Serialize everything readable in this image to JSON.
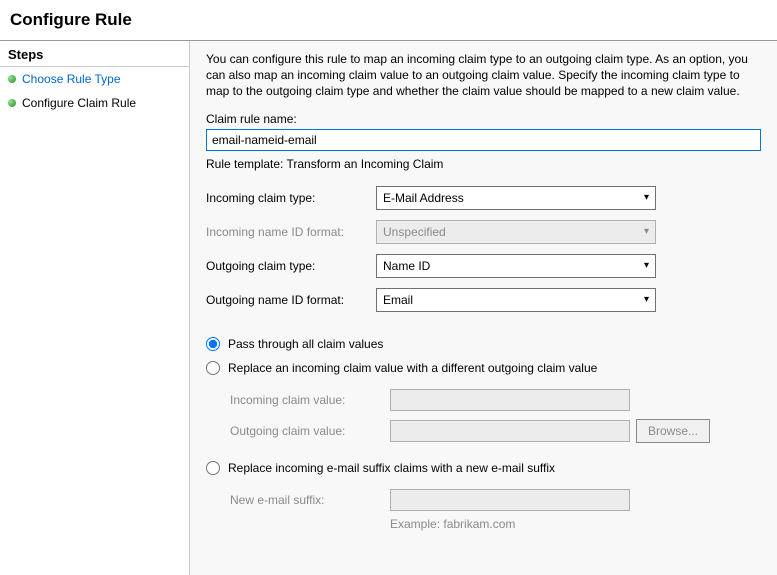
{
  "window_title": "Configure Rule",
  "sidebar": {
    "header": "Steps",
    "items": [
      {
        "label": "Choose Rule Type"
      },
      {
        "label": "Configure Claim Rule"
      }
    ]
  },
  "main": {
    "intro": "You can configure this rule to map an incoming claim type to an outgoing claim type. As an option, you can also map an incoming claim value to an outgoing claim value. Specify the incoming claim type to map to the outgoing claim type and whether the claim value should be mapped to a new claim value.",
    "claim_rule_name_label": "Claim rule name:",
    "claim_rule_name_value": "email-nameid-email",
    "rule_template_label": "Rule template: Transform an Incoming Claim",
    "rows": {
      "incoming_type_label": "Incoming claim type:",
      "incoming_type_value": "E-Mail Address",
      "incoming_nameid_label": "Incoming name ID format:",
      "incoming_nameid_value": "Unspecified",
      "outgoing_type_label": "Outgoing claim type:",
      "outgoing_type_value": "Name ID",
      "outgoing_nameid_label": "Outgoing name ID format:",
      "outgoing_nameid_value": "Email"
    },
    "radio": {
      "opt1": "Pass through all claim values",
      "opt2": "Replace an incoming claim value with a different outgoing claim value",
      "incoming_value_label": "Incoming claim value:",
      "outgoing_value_label": "Outgoing claim value:",
      "browse_label": "Browse...",
      "opt3": "Replace incoming e-mail suffix claims with a new e-mail suffix",
      "suffix_label": "New e-mail suffix:",
      "example": "Example: fabrikam.com"
    }
  }
}
